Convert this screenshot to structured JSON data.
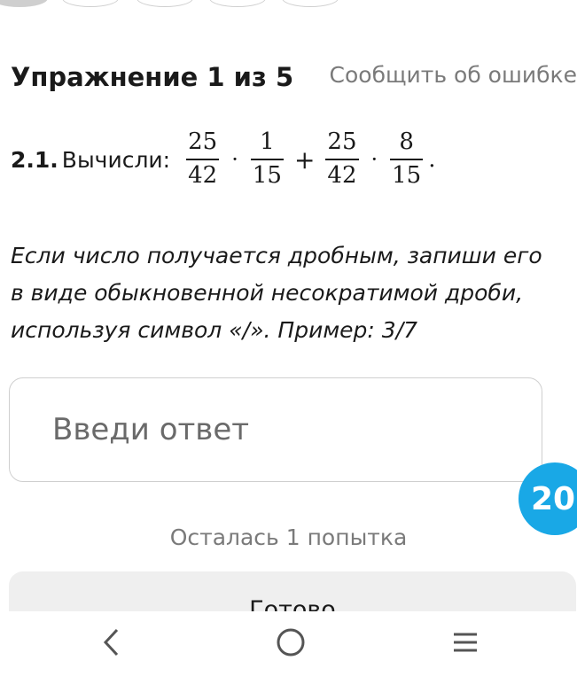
{
  "progress": {
    "current": 1,
    "total": 5
  },
  "header": {
    "title": "Упражнение 1 из 5",
    "report_link": "Сообщить об ошибке"
  },
  "problem": {
    "number": "2.1.",
    "verb": "Вычисли:",
    "fractions": [
      {
        "num": "25",
        "den": "42"
      },
      {
        "num": "1",
        "den": "15"
      },
      {
        "num": "25",
        "den": "42"
      },
      {
        "num": "8",
        "den": "15"
      }
    ],
    "operators": [
      "·",
      "+",
      "·"
    ],
    "end": "."
  },
  "instruction": "Если число получается дробным, запиши его в виде обыкновенной несократимой дроби, используя символ «/». Пример: 3/7",
  "answer": {
    "placeholder": "Введи ответ",
    "value": ""
  },
  "timer": "20",
  "attempts": "Осталась 1 попытка",
  "done_button": "Готово",
  "colors": {
    "accent": "#19a8e6",
    "muted": "#7a7a7a",
    "button_bg": "#efefef"
  },
  "nav": {
    "icons": [
      "back-icon",
      "home-icon",
      "menu-icon"
    ]
  }
}
